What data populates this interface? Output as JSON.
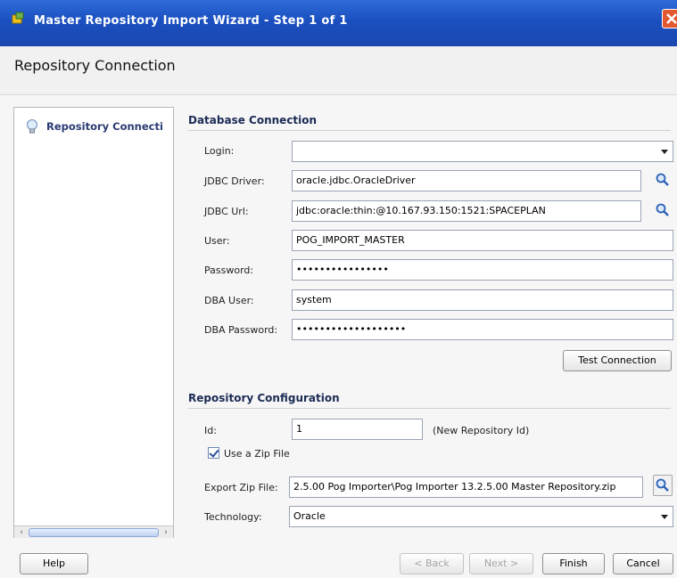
{
  "window": {
    "title": "Master Repository Import Wizard - Step 1 of 1"
  },
  "header": {
    "title": "Repository Connection"
  },
  "nav": {
    "items": [
      {
        "label": "Repository Connecti",
        "icon": "lightbulb-icon"
      }
    ]
  },
  "database_connection": {
    "section_title": "Database Connection",
    "login": {
      "label": "Login:",
      "value": ""
    },
    "jdbc_driver": {
      "label": "JDBC Driver:",
      "value": "oracle.jdbc.OracleDriver"
    },
    "jdbc_url": {
      "label": "JDBC Url:",
      "value": "jdbc:oracle:thin:@10.167.93.150:1521:SPACEPLAN"
    },
    "user": {
      "label": "User:",
      "value": "POG_IMPORT_MASTER"
    },
    "password": {
      "label": "Password:",
      "value": "••••••••••••••••"
    },
    "dba_user": {
      "label": "DBA User:",
      "value": "system"
    },
    "dba_password": {
      "label": "DBA Password:",
      "value": "•••••••••••••••••••"
    },
    "test_connection_label": "Test Connection"
  },
  "repository_configuration": {
    "section_title": "Repository Configuration",
    "id": {
      "label": "Id:",
      "value": "1",
      "hint": "(New Repository Id)"
    },
    "use_zip": {
      "label": "Use a Zip File",
      "checked": true
    },
    "export_zip": {
      "label": "Export Zip File:",
      "value": "2.5.00 Pog Importer\\Pog Importer 13.2.5.00 Master Repository.zip"
    },
    "technology": {
      "label": "Technology:",
      "value": "Oracle"
    }
  },
  "buttons": {
    "help": "Help",
    "back": "< Back",
    "next": "Next >",
    "finish": "Finish",
    "cancel": "Cancel"
  },
  "colors": {
    "titlebar": "#1b4fbf",
    "close": "#e2572d",
    "section_title": "#1c2b55",
    "nav_label": "#2a3b73"
  }
}
